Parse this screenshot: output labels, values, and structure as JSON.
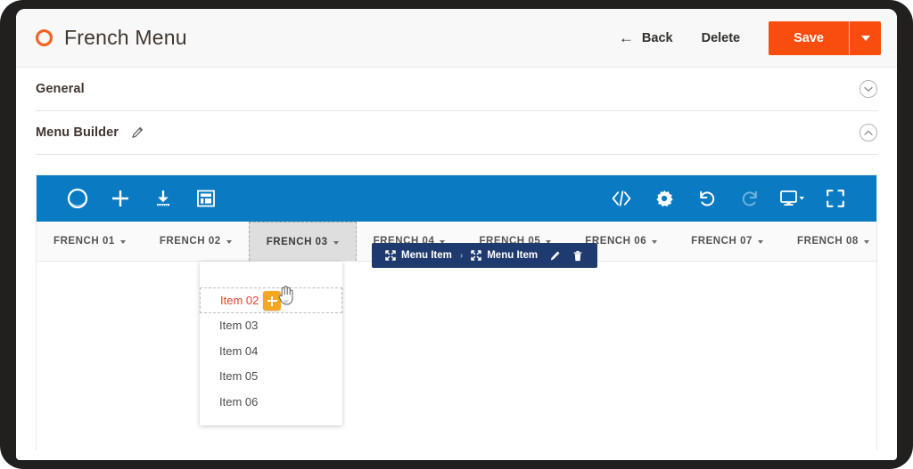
{
  "header": {
    "logo_icon": "magento-ring-logo",
    "title": "French Menu",
    "back_label": "Back",
    "back_icon": "arrow-left-icon",
    "delete_label": "Delete",
    "save_label": "Save",
    "save_caret_icon": "chevron-down-icon",
    "accent_color": "#f94d10",
    "logo_color": "#f26322"
  },
  "sections": [
    {
      "title": "General",
      "toggle_icon": "chevron-down-circle-icon",
      "expanded": false,
      "has_edit": false
    },
    {
      "title": "Menu Builder",
      "toggle_icon": "chevron-up-circle-icon",
      "expanded": true,
      "has_edit": true,
      "edit_icon": "pencil-icon"
    }
  ],
  "builder": {
    "toolbar_color": "#0a7ac2",
    "left_tools": [
      {
        "name": "logo-ring-icon",
        "label": "Page Builder",
        "disabled": false
      },
      {
        "name": "add-icon",
        "label": "Add",
        "disabled": false
      },
      {
        "name": "import-icon",
        "label": "Import",
        "disabled": false
      },
      {
        "name": "templates-icon",
        "label": "Templates",
        "disabled": false
      }
    ],
    "right_tools": [
      {
        "name": "code-icon",
        "label": "HTML Code",
        "disabled": false
      },
      {
        "name": "gear-icon",
        "label": "Settings",
        "disabled": false
      },
      {
        "name": "undo-icon",
        "label": "Undo",
        "disabled": false
      },
      {
        "name": "redo-icon",
        "label": "Redo",
        "disabled": true
      },
      {
        "name": "viewport-icon",
        "label": "Viewport",
        "disabled": false
      },
      {
        "name": "fullscreen-icon",
        "label": "Full Screen",
        "disabled": false
      }
    ],
    "tabs": [
      {
        "label": "FRENCH 01",
        "active": false
      },
      {
        "label": "FRENCH 02",
        "active": false
      },
      {
        "label": "FRENCH 03",
        "active": true
      },
      {
        "label": "FRENCH 04",
        "active": false
      },
      {
        "label": "FRENCH 05",
        "active": false
      },
      {
        "label": "FRENCH 06",
        "active": false
      },
      {
        "label": "FRENCH 07",
        "active": false
      },
      {
        "label": "FRENCH 08",
        "active": false
      }
    ],
    "element_toolbar": {
      "background": "#1f3a6e",
      "parent_label": "Menu Item",
      "parent_icon": "move-icon",
      "separator": "›",
      "child_label": "Menu Item",
      "child_icon": "move-icon",
      "edit_icon": "pencil-icon",
      "delete_icon": "trash-icon"
    },
    "dropdown": {
      "items": [
        {
          "label": "Item 02",
          "selected": true
        },
        {
          "label": "Item 03",
          "selected": false
        },
        {
          "label": "Item 04",
          "selected": false
        },
        {
          "label": "Item 05",
          "selected": false
        },
        {
          "label": "Item 06",
          "selected": false
        }
      ],
      "selected_color": "#f0412f",
      "add_badge_icon": "plus-icon",
      "add_badge_color": "#f5a623"
    },
    "cursor_icon": "hand-pointer-cursor"
  }
}
